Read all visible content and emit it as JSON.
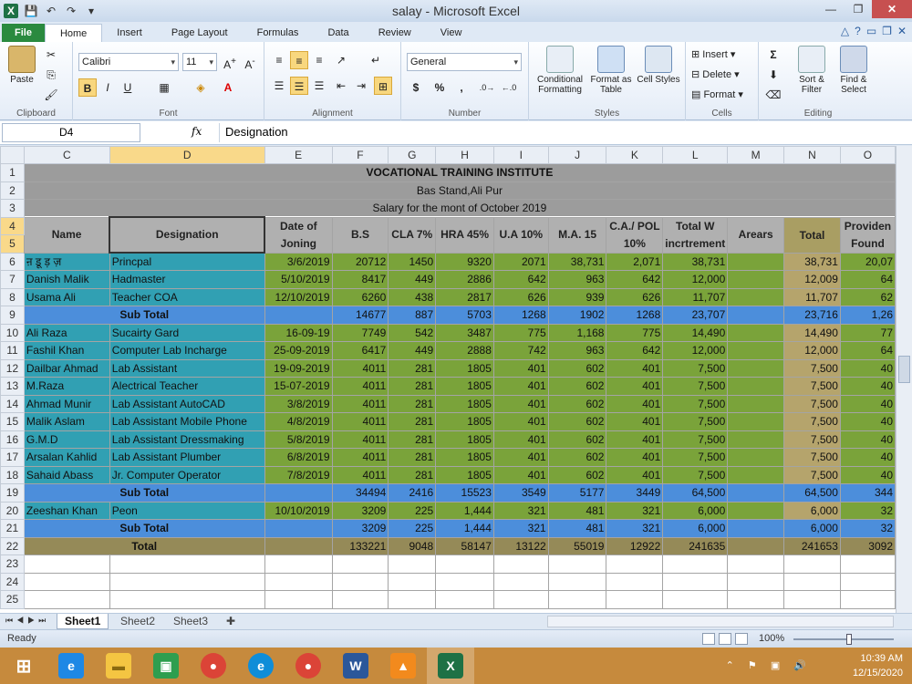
{
  "window": {
    "title": "salay - Microsoft Excel"
  },
  "ribbon": {
    "tabs": [
      "File",
      "Home",
      "Insert",
      "Page Layout",
      "Formulas",
      "Data",
      "Review",
      "View"
    ],
    "active_tab": "Home",
    "clipboard": {
      "label": "Clipboard",
      "paste": "Paste"
    },
    "font": {
      "label": "Font",
      "name": "Calibri",
      "size": "11",
      "bold": "B",
      "italic": "I",
      "underline": "U"
    },
    "alignment": {
      "label": "Alignment"
    },
    "number": {
      "label": "Number",
      "format": "General",
      "currency": "$",
      "percent": "%",
      "comma": ","
    },
    "styles": {
      "label": "Styles",
      "conditional": "Conditional Formatting",
      "format_table": "Format as Table",
      "cell_styles": "Cell Styles"
    },
    "cells": {
      "label": "Cells",
      "insert": "Insert",
      "delete": "Delete",
      "format": "Format"
    },
    "editing": {
      "label": "Editing",
      "sort": "Sort & Filter",
      "find": "Find & Select"
    }
  },
  "formula_bar": {
    "name_box": "D4",
    "fx": "fx",
    "content": "Designation"
  },
  "columns": [
    "C",
    "D",
    "E",
    "F",
    "G",
    "H",
    "I",
    "J",
    "K",
    "L",
    "M",
    "N",
    "O"
  ],
  "sheet": {
    "title": "VOCATIONAL TRAINING INSTITUTE",
    "subtitle": "Bas Stand,Ali Pur",
    "period": "Salary for the mont of October 2019",
    "headers": {
      "name": "Name",
      "designation": "Designation",
      "date": "Date of Joning",
      "bs": "B.S",
      "cla": "CLA 7%",
      "hra": "HRA 45%",
      "ua": "U.A 10%",
      "ma": "M.A. 15",
      "ca": "C.A./ POL 10%",
      "total_inc": "Total W incrtrement",
      "arears": "Arears",
      "total": "Total",
      "provident": "Providen Found"
    },
    "rows": [
      {
        "r": "6",
        "name": "ऩ डू ड़ ज़",
        "des": "Princpal",
        "date": "3/6/2019",
        "bs": "20712",
        "cla": "1450",
        "hra": "9320",
        "ua": "2071",
        "ma": "38,731",
        "ca": "2,071",
        "tw": "38,731",
        "ar": "",
        "tot": "38,731",
        "pf": "20,07"
      },
      {
        "r": "7",
        "name": "Danish Malik",
        "des": "Hadmaster",
        "date": "5/10/2019",
        "bs": "8417",
        "cla": "449",
        "hra": "2886",
        "ua": "642",
        "ma": "963",
        "ca": "642",
        "tw": "12,000",
        "ar": "",
        "tot": "12,009",
        "pf": "64"
      },
      {
        "r": "8",
        "name": "Usama Ali",
        "des": "Teacher COA",
        "date": "12/10/2019",
        "bs": "6260",
        "cla": "438",
        "hra": "2817",
        "ua": "626",
        "ma": "939",
        "ca": "626",
        "tw": "11,707",
        "ar": "",
        "tot": "11,707",
        "pf": "62"
      },
      {
        "r": "9",
        "sub": "Sub Total",
        "bs": "14677",
        "cla": "887",
        "hra": "5703",
        "ua": "1268",
        "ma": "1902",
        "ca": "1268",
        "tw": "23,707",
        "tot": "23,716",
        "pf": "1,26"
      },
      {
        "r": "10",
        "name": "Ali Raza",
        "des": "Sucairty Gard",
        "date": "16-09-19",
        "bs": "7749",
        "cla": "542",
        "hra": "3487",
        "ua": "775",
        "ma": "1,168",
        "ca": "775",
        "tw": "14,490",
        "ar": "",
        "tot": "14,490",
        "pf": "77"
      },
      {
        "r": "11",
        "name": "Fashil Khan",
        "des": "Computer Lab Incharge",
        "date": "25-09-2019",
        "bs": "6417",
        "cla": "449",
        "hra": "2888",
        "ua": "742",
        "ma": "963",
        "ca": "642",
        "tw": "12,000",
        "ar": "",
        "tot": "12,000",
        "pf": "64"
      },
      {
        "r": "12",
        "name": "Dailbar Ahmad",
        "des": "Lab Assistant",
        "date": "19-09-2019",
        "bs": "4011",
        "cla": "281",
        "hra": "1805",
        "ua": "401",
        "ma": "602",
        "ca": "401",
        "tw": "7,500",
        "ar": "",
        "tot": "7,500",
        "pf": "40"
      },
      {
        "r": "13",
        "name": "M.Raza",
        "des": "Alectrical Teacher",
        "date": "15-07-2019",
        "bs": "4011",
        "cla": "281",
        "hra": "1805",
        "ua": "401",
        "ma": "602",
        "ca": "401",
        "tw": "7,500",
        "ar": "",
        "tot": "7,500",
        "pf": "40"
      },
      {
        "r": "14",
        "name": "Ahmad Munir",
        "des": "Lab Assistant AutoCAD",
        "date": "3/8/2019",
        "bs": "4011",
        "cla": "281",
        "hra": "1805",
        "ua": "401",
        "ma": "602",
        "ca": "401",
        "tw": "7,500",
        "ar": "",
        "tot": "7,500",
        "pf": "40"
      },
      {
        "r": "15",
        "name": "Malik Aslam",
        "des": "Lab Assistant Mobile Phone",
        "date": "4/8/2019",
        "bs": "4011",
        "cla": "281",
        "hra": "1805",
        "ua": "401",
        "ma": "602",
        "ca": "401",
        "tw": "7,500",
        "ar": "",
        "tot": "7,500",
        "pf": "40"
      },
      {
        "r": "16",
        "name": "G.M.D",
        "des": "Lab Assistant Dressmaking",
        "date": "5/8/2019",
        "bs": "4011",
        "cla": "281",
        "hra": "1805",
        "ua": "401",
        "ma": "602",
        "ca": "401",
        "tw": "7,500",
        "ar": "",
        "tot": "7,500",
        "pf": "40"
      },
      {
        "r": "17",
        "name": "Arsalan Kahlid",
        "des": "Lab Assistant Plumber",
        "date": "6/8/2019",
        "bs": "4011",
        "cla": "281",
        "hra": "1805",
        "ua": "401",
        "ma": "602",
        "ca": "401",
        "tw": "7,500",
        "ar": "",
        "tot": "7,500",
        "pf": "40"
      },
      {
        "r": "18",
        "name": "Sahaid Abass",
        "des": "Jr. Computer Operator",
        "date": "7/8/2019",
        "bs": "4011",
        "cla": "281",
        "hra": "1805",
        "ua": "401",
        "ma": "602",
        "ca": "401",
        "tw": "7,500",
        "ar": "",
        "tot": "7,500",
        "pf": "40"
      },
      {
        "r": "19",
        "sub": "Sub Total",
        "bs": "34494",
        "cla": "2416",
        "hra": "15523",
        "ua": "3549",
        "ma": "5177",
        "ca": "3449",
        "tw": "64,500",
        "tot": "64,500",
        "pf": "344"
      },
      {
        "r": "20",
        "name": "Zeeshan Khan",
        "des": "Peon",
        "date": "10/10/2019",
        "bs": "3209",
        "cla": "225",
        "hra": "1,444",
        "ua": "321",
        "ma": "481",
        "ca": "321",
        "tw": "6,000",
        "ar": "",
        "tot": "6,000",
        "pf": "32"
      },
      {
        "r": "21",
        "sub": "Sub Total",
        "bs": "3209",
        "cla": "225",
        "hra": "1,444",
        "ua": "321",
        "ma": "481",
        "ca": "321",
        "tw": "6,000",
        "tot": "6,000",
        "pf": "32"
      },
      {
        "r": "22",
        "grand": "Total",
        "bs": "133221",
        "cla": "9048",
        "hra": "58147",
        "ua": "13122",
        "ma": "55019",
        "ca": "12922",
        "tw": "241635",
        "tot": "241653",
        "pf": "3092"
      }
    ],
    "empty_rows": [
      "23",
      "24",
      "25"
    ]
  },
  "sheet_tabs": [
    "Sheet1",
    "Sheet2",
    "Sheet3"
  ],
  "status": {
    "ready": "Ready",
    "zoom": "100%"
  },
  "tray": {
    "time": "10:39 AM",
    "date": "12/15/2020"
  }
}
